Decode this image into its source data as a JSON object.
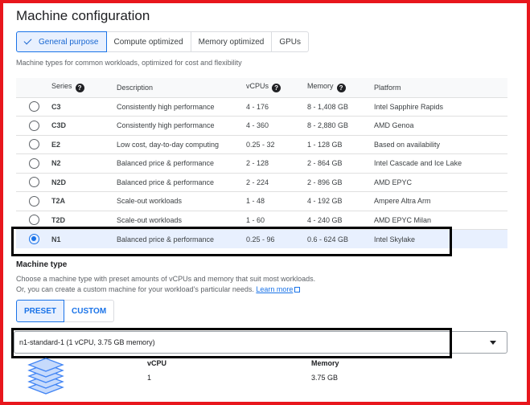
{
  "section_title": "Machine configuration",
  "tabs": [
    {
      "label": "General purpose",
      "active": true
    },
    {
      "label": "Compute optimized",
      "active": false
    },
    {
      "label": "Memory optimized",
      "active": false
    },
    {
      "label": "GPUs",
      "active": false
    }
  ],
  "tab_description": "Machine types for common workloads, optimized for cost and flexibility",
  "table": {
    "headers": {
      "series": "Series",
      "description": "Description",
      "vcpus": "vCPUs",
      "memory": "Memory",
      "platform": "Platform"
    },
    "rows": [
      {
        "series": "C3",
        "description": "Consistently high performance",
        "vcpus": "4 - 176",
        "memory": "8 - 1,408 GB",
        "platform": "Intel Sapphire Rapids",
        "selected": false
      },
      {
        "series": "C3D",
        "description": "Consistently high performance",
        "vcpus": "4 - 360",
        "memory": "8 - 2,880 GB",
        "platform": "AMD Genoa",
        "selected": false
      },
      {
        "series": "E2",
        "description": "Low cost, day-to-day computing",
        "vcpus": "0.25 - 32",
        "memory": "1 - 128 GB",
        "platform": "Based on availability",
        "selected": false
      },
      {
        "series": "N2",
        "description": "Balanced price & performance",
        "vcpus": "2 - 128",
        "memory": "2 - 864 GB",
        "platform": "Intel Cascade and Ice Lake",
        "selected": false
      },
      {
        "series": "N2D",
        "description": "Balanced price & performance",
        "vcpus": "2 - 224",
        "memory": "2 - 896 GB",
        "platform": "AMD EPYC",
        "selected": false
      },
      {
        "series": "T2A",
        "description": "Scale-out workloads",
        "vcpus": "1 - 48",
        "memory": "4 - 192 GB",
        "platform": "Ampere Altra Arm",
        "selected": false
      },
      {
        "series": "T2D",
        "description": "Scale-out workloads",
        "vcpus": "1 - 60",
        "memory": "4 - 240 GB",
        "platform": "AMD EPYC Milan",
        "selected": false
      },
      {
        "series": "N1",
        "description": "Balanced price & performance",
        "vcpus": "0.25 - 96",
        "memory": "0.6 - 624 GB",
        "platform": "Intel Skylake",
        "selected": true
      }
    ]
  },
  "machine_type": {
    "label": "Machine type",
    "description_line1": "Choose a machine type with preset amounts of vCPUs and memory that suit most workloads.",
    "description_line2": "Or, you can create a custom machine for your workload's particular needs.",
    "learn_more": "Learn more",
    "preset_label": "PRESET",
    "custom_label": "CUSTOM",
    "selected_value": "n1-standard-1 (1 vCPU, 3.75 GB memory)",
    "vcpu_header": "vCPU",
    "vcpu_value": "1",
    "memory_header": "Memory",
    "memory_value": "3.75 GB"
  },
  "colors": {
    "highlight_border": "#e8161c",
    "accent": "#1a73e8",
    "selected_row_bg": "#e8f0fe",
    "annotation_box": "#000000"
  },
  "icons": {
    "help": "help-circle-icon",
    "check": "check-icon",
    "external_link": "external-link-icon",
    "dropdown": "caret-down-icon",
    "machine": "layers-stack-icon"
  }
}
